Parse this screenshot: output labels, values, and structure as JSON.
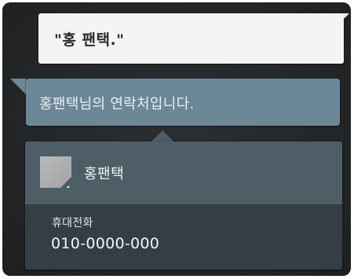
{
  "conversation": {
    "user_query": "\"홍 팬택.\"",
    "assistant_response": "홍팬택님의 연락처입니다."
  },
  "contact_card": {
    "avatar_icon": "default-contact-photo-icon",
    "name": "홍팬택",
    "phone_label": "휴대전화",
    "phone_number": "010-0000-000"
  },
  "colors": {
    "background": "#262829",
    "user_bubble": "#f4f4f4",
    "assistant_bubble": "#6c8796",
    "card_header": "#4e5e67",
    "card_body": "#353e44"
  }
}
